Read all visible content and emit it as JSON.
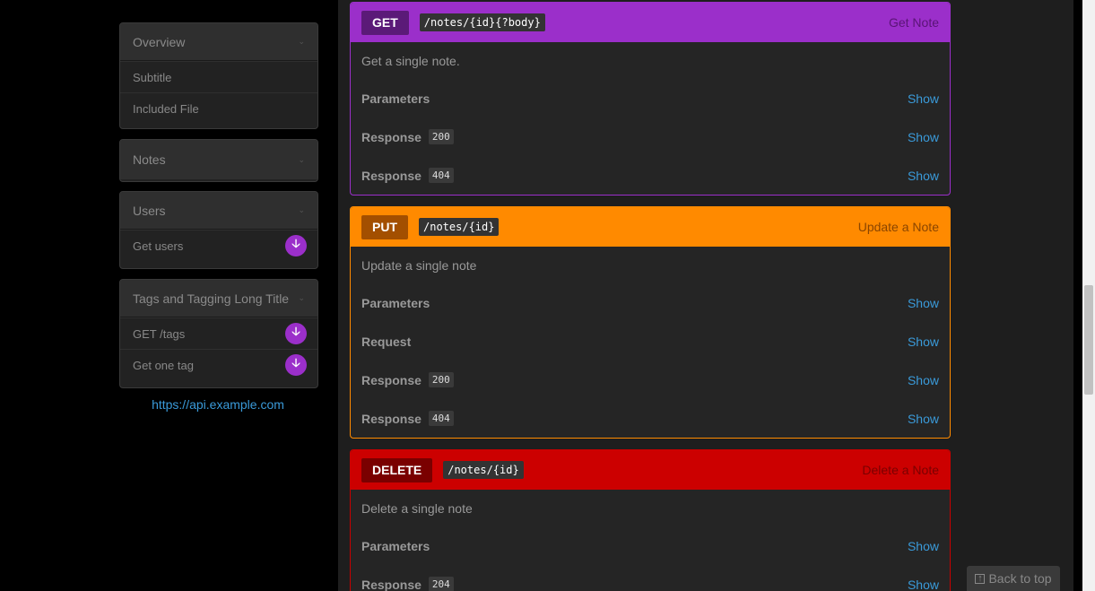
{
  "sidebar": {
    "groups": [
      {
        "title": "Overview",
        "items": [
          {
            "label": "Subtitle"
          },
          {
            "label": "Included File"
          }
        ]
      },
      {
        "title": "Notes",
        "items": []
      },
      {
        "title": "Users",
        "items": [
          {
            "label": "Get users"
          }
        ]
      },
      {
        "title": "Tags and Tagging Long Title",
        "items": [
          {
            "label": "GET /tags"
          },
          {
            "label": "Get one tag"
          }
        ]
      }
    ],
    "api_link": "https://api.example.com"
  },
  "endpoints": [
    {
      "method": "GET",
      "path": "/notes/{id}{?body}",
      "title": "Get Note",
      "description": "Get a single note.",
      "rows": [
        {
          "label": "Parameters",
          "code": "",
          "action": "Show"
        },
        {
          "label": "Response",
          "code": "200",
          "action": "Show"
        },
        {
          "label": "Response",
          "code": "404",
          "action": "Show"
        }
      ]
    },
    {
      "method": "PUT",
      "path": "/notes/{id}",
      "title": "Update a Note",
      "description": "Update a single note",
      "rows": [
        {
          "label": "Parameters",
          "code": "",
          "action": "Show"
        },
        {
          "label": "Request",
          "code": "",
          "action": "Show"
        },
        {
          "label": "Response",
          "code": "200",
          "action": "Show"
        },
        {
          "label": "Response",
          "code": "404",
          "action": "Show"
        }
      ]
    },
    {
      "method": "DELETE",
      "path": "/notes/{id}",
      "title": "Delete a Note",
      "description": "Delete a single note",
      "rows": [
        {
          "label": "Parameters",
          "code": "",
          "action": "Show"
        },
        {
          "label": "Response",
          "code": "204",
          "action": "Show"
        }
      ]
    }
  ],
  "back_to_top": "Back to top",
  "colors": {
    "get": "#9b2fca",
    "put": "#ff8a00",
    "delete": "#cc0000",
    "link": "#3a9ad9"
  },
  "icons": {
    "chevron": "chevron-down-icon",
    "download": "arrow-down-circle-icon",
    "back_to_top": "arrow-up-square-icon"
  }
}
